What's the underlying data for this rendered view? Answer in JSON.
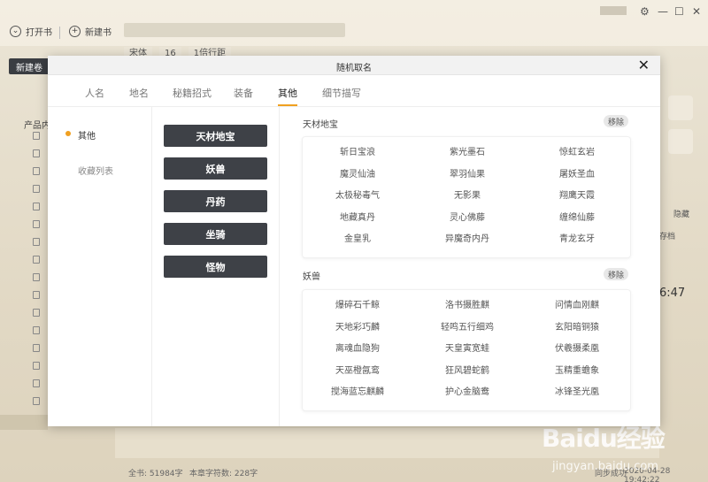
{
  "app": {
    "toolbar": {
      "open_book": "打开书",
      "new_book": "新建书"
    },
    "new_volume": "新建卷",
    "format": {
      "font": "宋体",
      "size": "16",
      "line_spacing": "1倍行距"
    },
    "tree_label": "产品内",
    "right_panel": {
      "hide": "隐藏",
      "action": "存档",
      "clock": "6:47"
    },
    "status": {
      "total": "全书: 51984字",
      "chapter": "本章字符数: 228字",
      "sync": "同步成功",
      "datetime": "2020-04-28 19:42:22"
    },
    "watermark": {
      "brand": "Baidu经验",
      "url": "jingyan.baidu.com"
    }
  },
  "modal": {
    "title": "随机取名",
    "tabs": [
      {
        "label": "人名"
      },
      {
        "label": "地名"
      },
      {
        "label": "秘籍招式"
      },
      {
        "label": "装备"
      },
      {
        "label": "其他"
      },
      {
        "label": "细节描写"
      }
    ],
    "active_tab": "其他",
    "categories": [
      {
        "label": "其他"
      },
      {
        "label": "收藏列表"
      }
    ],
    "types": [
      {
        "label": "天材地宝"
      },
      {
        "label": "妖兽"
      },
      {
        "label": "丹药"
      },
      {
        "label": "坐骑"
      },
      {
        "label": "怪物"
      }
    ],
    "remove_label": "移除",
    "groups": [
      {
        "title": "天材地宝",
        "names": [
          "斩日宝浪",
          "紫光墨石",
          "惊虹玄岩",
          "魔灵仙油",
          "翠羽仙果",
          "屠妖圣血",
          "太极秘毒气",
          "无影果",
          "翔鹰天霞",
          "地藏真丹",
          "灵心佛藤",
          "缠绵仙藤",
          "金皇乳",
          "异魔奇内丹",
          "青龙玄牙"
        ]
      },
      {
        "title": "妖兽",
        "names": [
          "爆碎石千鲸",
          "洛书摄胜麒",
          "问情血刚麒",
          "天地彩巧麟",
          "轻鸣五行细鸡",
          "玄阳暗铜猿",
          "离魂血隐狗",
          "天皇寅宽蛙",
          "伏羲摄柔凰",
          "天巫橙氤鸾",
          "狂风碧蛇鹤",
          "玉精重蟾象",
          "搅海蓝忘麒麟",
          "护心金脑鸯",
          "冰锋圣光凰"
        ]
      }
    ]
  },
  "colors": {
    "accent": "#f0a020",
    "dark_button": "#3e4147"
  }
}
